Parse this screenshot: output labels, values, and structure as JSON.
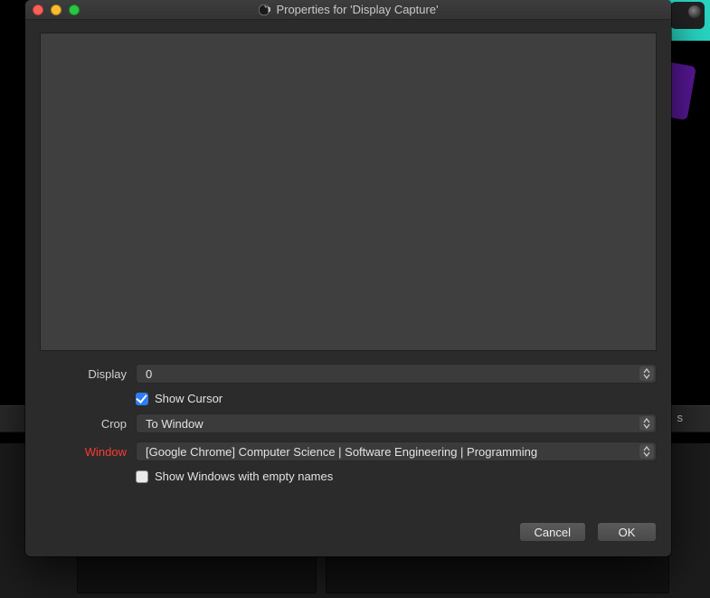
{
  "window": {
    "title": "Properties for 'Display Capture'"
  },
  "form": {
    "display_label": "Display",
    "display_value": "0",
    "show_cursor_label": "Show Cursor",
    "show_cursor_checked": true,
    "crop_label": "Crop",
    "crop_value": "To Window",
    "window_label": "Window",
    "window_value": "[Google Chrome] Computer Science | Software Engineering | Programming",
    "window_label_error": true,
    "show_empty_label": "Show Windows with empty names",
    "show_empty_checked": false
  },
  "buttons": {
    "cancel": "Cancel",
    "ok": "OK"
  },
  "bg": {
    "strip_letter": "s"
  }
}
